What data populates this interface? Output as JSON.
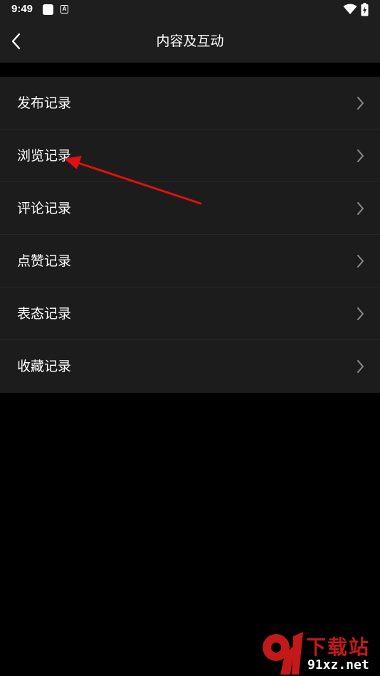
{
  "status_bar": {
    "time": "9:49",
    "notification_letter": "A"
  },
  "header": {
    "title": "内容及互动"
  },
  "menu": {
    "items": [
      {
        "label": "发布记录"
      },
      {
        "label": "浏览记录"
      },
      {
        "label": "评论记录"
      },
      {
        "label": "点赞记录"
      },
      {
        "label": "表态记录"
      },
      {
        "label": "收藏记录"
      }
    ]
  },
  "watermark": {
    "title": "下载站",
    "domain": "91xz.net"
  },
  "colors": {
    "background": "#000000",
    "header_background": "#1e1e1e",
    "list_background": "#1c1c1c",
    "divider": "#262626",
    "chevron": "#8a8a8a",
    "annotation_arrow": "#e01010",
    "watermark_red": "#c21919"
  },
  "icons": {
    "back": "chevron-left-icon",
    "row": "chevron-right-icon",
    "wifi": "wifi-icon",
    "battery": "battery-charging-icon"
  }
}
